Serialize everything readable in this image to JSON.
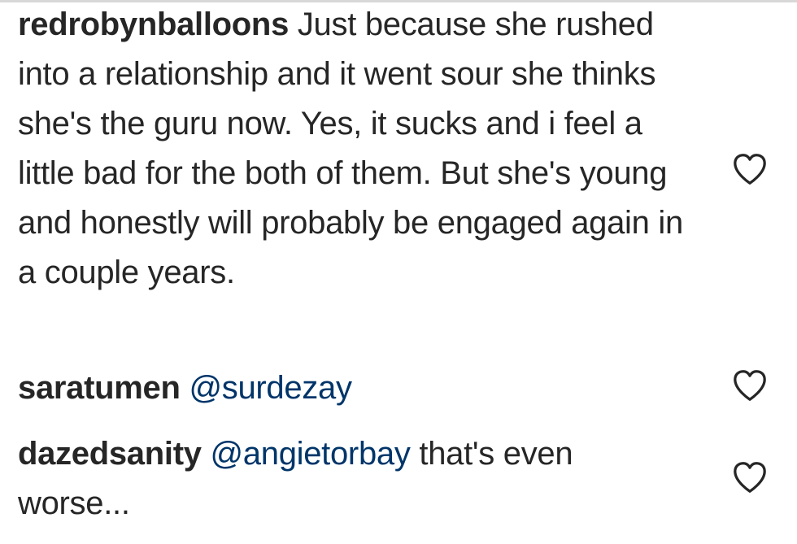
{
  "comments": [
    {
      "username": "redrobynballoons",
      "text": "Just because she rushed into a relationship and it went sour she thinks she's the guru now. Yes, it sucks and i feel a little bad for the both of them. But she's young and honestly will probably be engaged again in a couple years.",
      "icon": "heart-outline-icon"
    },
    {
      "username": "saratumen",
      "mention": "@surdezay",
      "text": "",
      "icon": "heart-outline-icon"
    },
    {
      "username": "dazedsanity",
      "mention": "@angietorbay",
      "text": "that's even worse...",
      "icon": "heart-outline-icon"
    }
  ],
  "colors": {
    "text": "#262626",
    "mention": "#003569",
    "icon_stroke": "#262626"
  }
}
